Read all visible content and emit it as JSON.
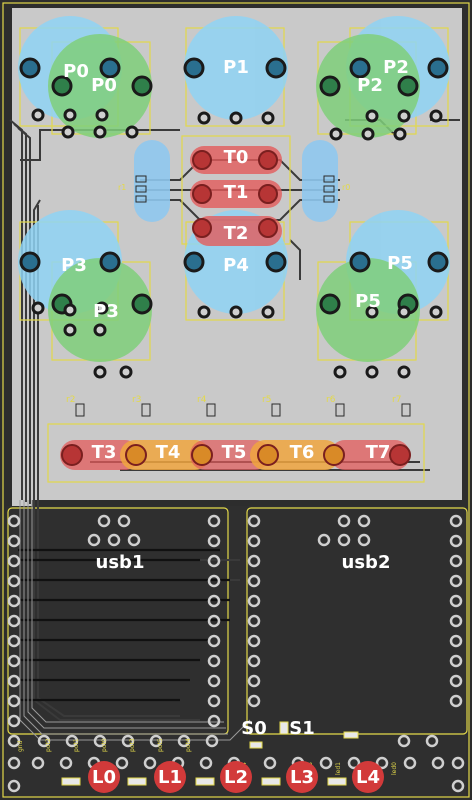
{
  "colors": {
    "board": "#2d2d2d",
    "copper": "#c8c8c8",
    "silk": "#e3d94a",
    "trace": "#353535",
    "pad_ring": "#1f1f1f",
    "blue_zone": "#8fd3f4",
    "green_zone": "#7fcf7a",
    "red_zone": "#e35b5b",
    "orange_zone": "#f0a640",
    "led_red": "#d23a3a"
  },
  "pots_blue": [
    {
      "label": "P0"
    },
    {
      "label": "P1"
    },
    {
      "label": "P2"
    },
    {
      "label": "P3"
    },
    {
      "label": "P4"
    },
    {
      "label": "P5"
    }
  ],
  "pots_green": [
    {
      "label": "P0"
    },
    {
      "label": "P2"
    },
    {
      "label": "P3"
    },
    {
      "label": "P5"
    }
  ],
  "touch_vertical": [
    {
      "label": "T0"
    },
    {
      "label": "T1"
    },
    {
      "label": "T2"
    }
  ],
  "touch_horizontal": [
    {
      "label": "T3"
    },
    {
      "label": "T4"
    },
    {
      "label": "T5"
    },
    {
      "label": "T6"
    },
    {
      "label": "T7"
    }
  ],
  "resistor_labels": [
    "r2",
    "r3",
    "r4",
    "r5",
    "r6",
    "r7"
  ],
  "resistor_labels_small": [
    "r1",
    "r0"
  ],
  "usb_modules": [
    {
      "label": "usb1"
    },
    {
      "label": "usb2"
    }
  ],
  "switches": [
    {
      "label": "S0"
    },
    {
      "label": "S1"
    }
  ],
  "leds": [
    {
      "label": "L0"
    },
    {
      "label": "L1"
    },
    {
      "label": "L2"
    },
    {
      "label": "L3"
    },
    {
      "label": "L4"
    }
  ],
  "header_pins": [
    "gnd",
    "pot2",
    "pot1",
    "pot0",
    "pot3",
    "pot5",
    "pot4",
    "led4",
    "led3",
    "led1",
    "led0"
  ]
}
